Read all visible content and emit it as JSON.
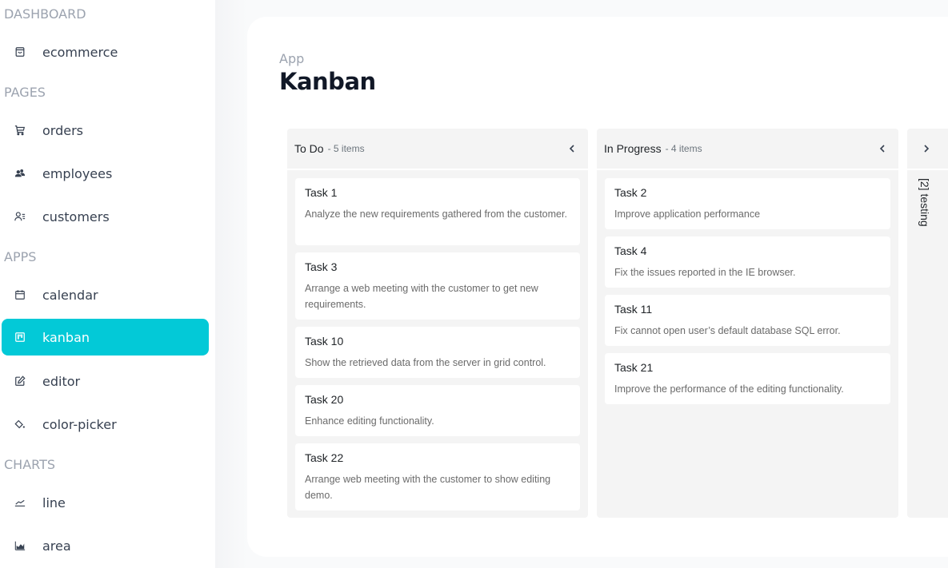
{
  "sidebar": {
    "sections": [
      {
        "title": "DASHBOARD",
        "items": [
          {
            "label": "ecommerce",
            "icon": "shopping-bag-icon"
          }
        ]
      },
      {
        "title": "PAGES",
        "items": [
          {
            "label": "orders",
            "icon": "cart-icon"
          },
          {
            "label": "employees",
            "icon": "people-icon"
          },
          {
            "label": "customers",
            "icon": "user-list-icon"
          }
        ]
      },
      {
        "title": "APPS",
        "items": [
          {
            "label": "calendar",
            "icon": "calendar-icon"
          },
          {
            "label": "kanban",
            "icon": "kanban-icon",
            "active": true
          },
          {
            "label": "editor",
            "icon": "edit-icon"
          },
          {
            "label": "color-picker",
            "icon": "paint-bucket-icon"
          }
        ]
      },
      {
        "title": "CHARTS",
        "items": [
          {
            "label": "line",
            "icon": "line-chart-icon"
          },
          {
            "label": "area",
            "icon": "area-chart-icon"
          }
        ]
      }
    ]
  },
  "header": {
    "breadcrumb": "App",
    "title": "Kanban"
  },
  "kanban": {
    "columns": [
      {
        "title": "To Do",
        "count_label": "- 5 items",
        "cards": [
          {
            "title": "Task 1",
            "desc": "Analyze the new requirements gathered from the customer."
          },
          {
            "title": "Task 3",
            "desc": "Arrange a web meeting with the customer to get new requirements."
          },
          {
            "title": "Task 10",
            "desc": "Show the retrieved data from the server in grid control."
          },
          {
            "title": "Task 20",
            "desc": "Enhance editing functionality."
          },
          {
            "title": "Task 22",
            "desc": "Arrange web meeting with the customer to show editing demo."
          }
        ]
      },
      {
        "title": "In Progress",
        "count_label": "- 4 items",
        "cards": [
          {
            "title": "Task 2",
            "desc": "Improve application performance"
          },
          {
            "title": "Task 4",
            "desc": "Fix the issues reported in the IE browser."
          },
          {
            "title": "Task 11",
            "desc": "Fix cannot open user’s default database SQL error."
          },
          {
            "title": "Task 21",
            "desc": "Improve the performance of the editing functionality."
          }
        ]
      }
    ],
    "collapsed_column": {
      "label": "[2] testing"
    }
  },
  "colors": {
    "accent": "#03c9d7",
    "column_bg": "#f4f4f4",
    "page_bg": "#f9fafb"
  }
}
